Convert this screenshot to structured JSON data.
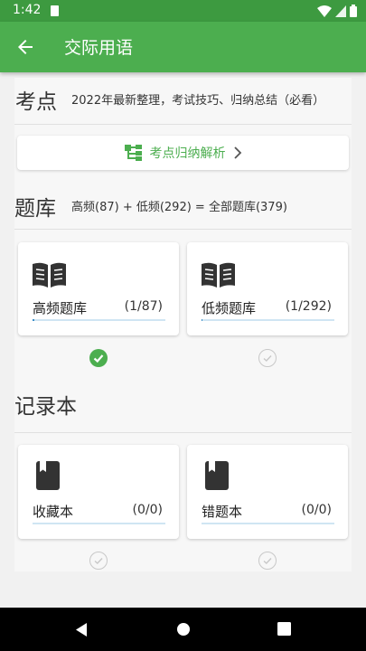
{
  "status": {
    "time": "1:42"
  },
  "appbar": {
    "title": "交际用语"
  },
  "kaodian": {
    "title": "考点",
    "desc": "2022年最新整理，考试技巧、归纳总结（必看）",
    "button_label": "考点归纳解析"
  },
  "tiku": {
    "title": "题库",
    "desc": "高频(87) + 低频(292) = 全部题库(379)",
    "cards": [
      {
        "name": "高频题库",
        "count": "(1/87)",
        "progress": 0.0115,
        "checked": true
      },
      {
        "name": "低频题库",
        "count": "(1/292)",
        "progress": 0.0034,
        "checked": false
      }
    ]
  },
  "jilu": {
    "title": "记录本",
    "cards": [
      {
        "name": "收藏本",
        "count": "(0/0)",
        "progress": 0,
        "checked": false
      },
      {
        "name": "错题本",
        "count": "(0/0)",
        "progress": 0,
        "checked": false
      }
    ]
  },
  "colors": {
    "primary": "#4cae4f",
    "status": "#3d9a40",
    "progress": "#3f8fc7"
  }
}
